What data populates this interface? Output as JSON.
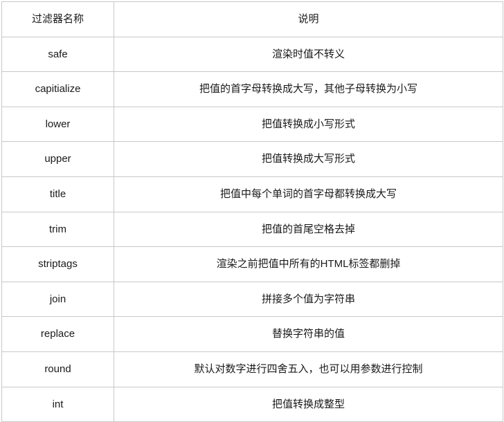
{
  "table": {
    "caption": "",
    "columns": [
      {
        "key": "name",
        "label": "过滤器名称"
      },
      {
        "key": "description",
        "label": "说明"
      }
    ],
    "rows": [
      {
        "name": "safe",
        "description": "渲染时值不转义"
      },
      {
        "name": "capitialize",
        "description": "把值的首字母转换成大写，其他子母转换为小写"
      },
      {
        "name": "lower",
        "description": "把值转换成小写形式"
      },
      {
        "name": "upper",
        "description": "把值转换成大写形式"
      },
      {
        "name": "title",
        "description": "把值中每个单词的首字母都转换成大写"
      },
      {
        "name": "trim",
        "description": "把值的首尾空格去掉"
      },
      {
        "name": "striptags",
        "description": "渲染之前把值中所有的HTML标签都删掉"
      },
      {
        "name": "join",
        "description": "拼接多个值为字符串"
      },
      {
        "name": "replace",
        "description": "替换字符串的值"
      },
      {
        "name": "round",
        "description": "默认对数字进行四舍五入，也可以用参数进行控制"
      },
      {
        "name": "int",
        "description": "把值转换成整型"
      }
    ]
  },
  "colors": {
    "border": "#c8c8c8",
    "text": "#1a1a1a",
    "background": "#ffffff"
  }
}
